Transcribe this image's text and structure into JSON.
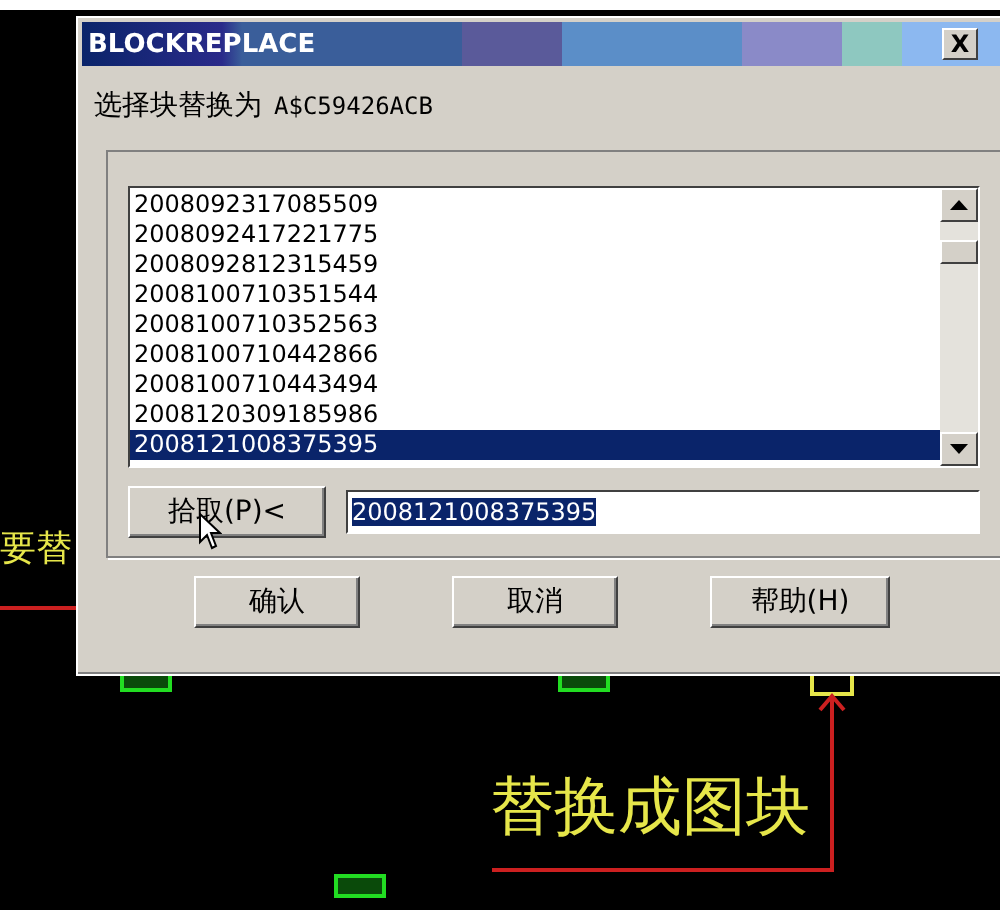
{
  "canvas": {
    "texts": [
      {
        "text": "要替",
        "kind": "left"
      },
      {
        "text": "替换成图块",
        "kind": "callout"
      }
    ]
  },
  "dialog": {
    "title": "BLOCKREPLACE",
    "close": "X",
    "prompt": "选择块替换为",
    "block_name": "A$C59426ACB",
    "list": [
      {
        "text": "2008092317085509",
        "selected": false
      },
      {
        "text": "2008092417221775",
        "selected": false
      },
      {
        "text": "2008092812315459",
        "selected": false
      },
      {
        "text": "2008100710351544",
        "selected": false
      },
      {
        "text": "2008100710352563",
        "selected": false
      },
      {
        "text": "2008100710442866",
        "selected": false
      },
      {
        "text": "2008100710443494",
        "selected": false
      },
      {
        "text": "2008120309185986",
        "selected": false
      },
      {
        "text": "2008121008375395",
        "selected": true
      }
    ],
    "pick_button": "拾取(P)<",
    "field": {
      "value": "2008121008375395",
      "highlighted": true
    },
    "buttons": [
      "确认",
      "取消",
      "帮助(H)"
    ]
  }
}
